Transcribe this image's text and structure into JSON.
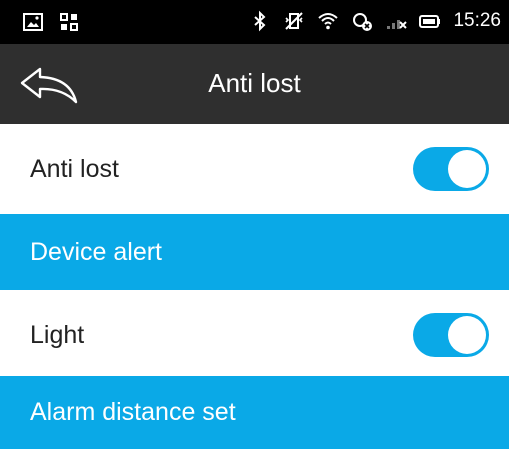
{
  "status_bar": {
    "left_icons": [
      "image-icon",
      "grid-icon"
    ],
    "right_icons": [
      "bluetooth-icon",
      "vibrate-icon",
      "wifi-icon",
      "sync-error-icon",
      "signal-icon",
      "battery-icon"
    ],
    "time": "15:26"
  },
  "app_bar": {
    "back_icon": "back-arrow-icon",
    "title": "Anti lost"
  },
  "settings": [
    {
      "label": "Anti lost",
      "type": "toggle",
      "on": true
    },
    {
      "label": "Device alert",
      "type": "action"
    },
    {
      "label": "Light",
      "type": "toggle",
      "on": true
    },
    {
      "label": "Alarm distance set",
      "type": "action"
    }
  ],
  "colors": {
    "accent": "#0aa9e7",
    "app_bar": "#2f2f2f",
    "status_bar": "#000000"
  }
}
